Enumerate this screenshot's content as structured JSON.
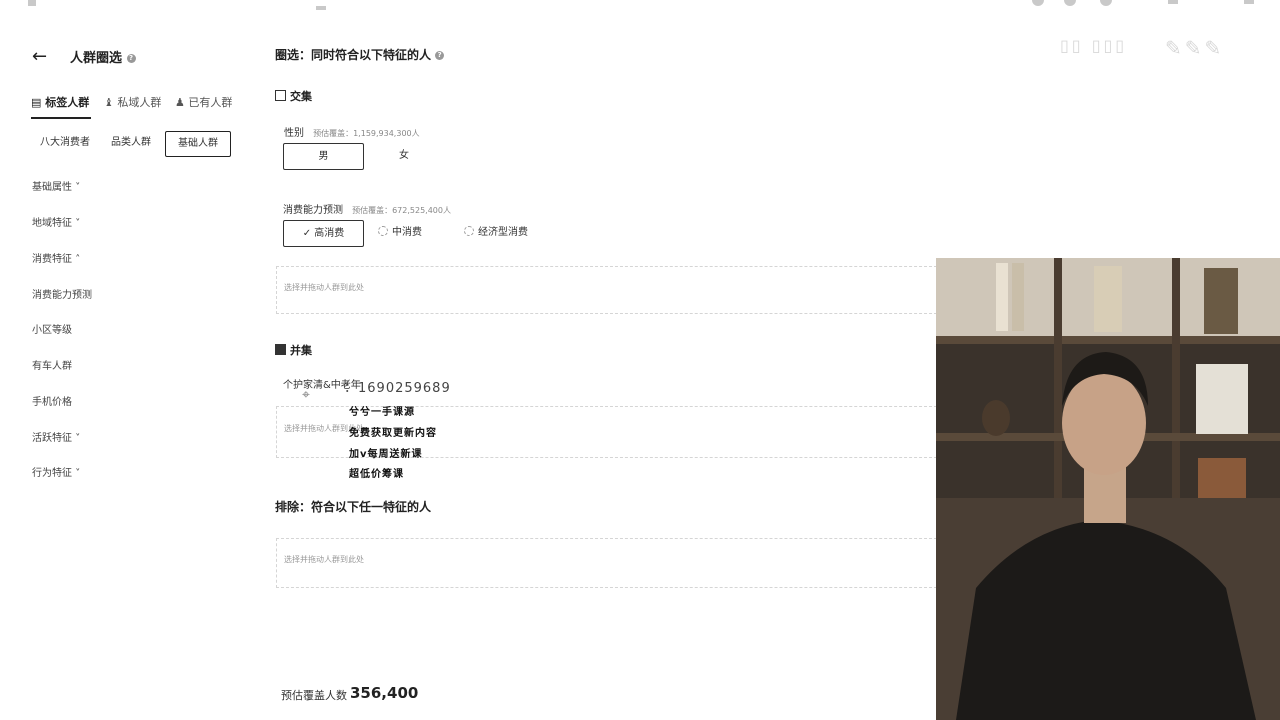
{
  "sidebar": {
    "title": "人群圈选",
    "tabs": [
      {
        "label": "标签人群",
        "active": true
      },
      {
        "label": "私域人群",
        "active": false
      },
      {
        "label": "已有人群",
        "active": false
      }
    ],
    "subtabs": [
      {
        "label": "八大消费者",
        "selected": false
      },
      {
        "label": "品类人群",
        "selected": false
      },
      {
        "label": "基础人群",
        "selected": true
      }
    ],
    "nav": [
      {
        "label": "基础属性",
        "chevron": "˅"
      },
      {
        "label": "地域特征",
        "chevron": "˅"
      },
      {
        "label": "消费特征",
        "chevron": "˄"
      },
      {
        "label": "消费能力预测",
        "chevron": ""
      },
      {
        "label": "小区等级",
        "chevron": ""
      },
      {
        "label": "有车人群",
        "chevron": ""
      },
      {
        "label": "手机价格",
        "chevron": ""
      },
      {
        "label": "活跃特征",
        "chevron": "˅"
      },
      {
        "label": "行为特征",
        "chevron": "˅"
      }
    ]
  },
  "main": {
    "title": "圈选：同时符合以下特征的人",
    "intersection": {
      "heading": "交集",
      "gender": {
        "label": "性别",
        "note": "预估覆盖：1,159,934,300人",
        "options": [
          {
            "label": "男",
            "selected": true
          },
          {
            "label": "女",
            "selected": false
          }
        ]
      },
      "spending": {
        "label": "消费能力预测",
        "note": "预估覆盖：672,525,400人",
        "options": [
          {
            "label": "✓ 高消费",
            "selected": true
          },
          {
            "label": "中消费",
            "selected": false
          },
          {
            "label": "经济型消费",
            "selected": false
          }
        ]
      },
      "drop_hint": "选择并拖动人群到此处"
    },
    "union": {
      "heading": "并集",
      "item_label": "个护家清&中老年",
      "drop_hint": "选择并拖动人群到此处"
    },
    "exclude": {
      "heading": "排除：符合以下任一特征的人",
      "drop_hint": "选择并拖动人群到此处"
    },
    "footer": {
      "label": "预估覆盖人数",
      "value": "356,400"
    }
  },
  "overlay": {
    "phone": "：1690259689",
    "lines": [
      "兮兮一手课源",
      "免费获取更新内容",
      "加v每周送新课",
      "超低价筹课"
    ]
  },
  "colors": {
    "accent": "#222222",
    "muted": "#999999",
    "border": "#d5d5d5"
  }
}
